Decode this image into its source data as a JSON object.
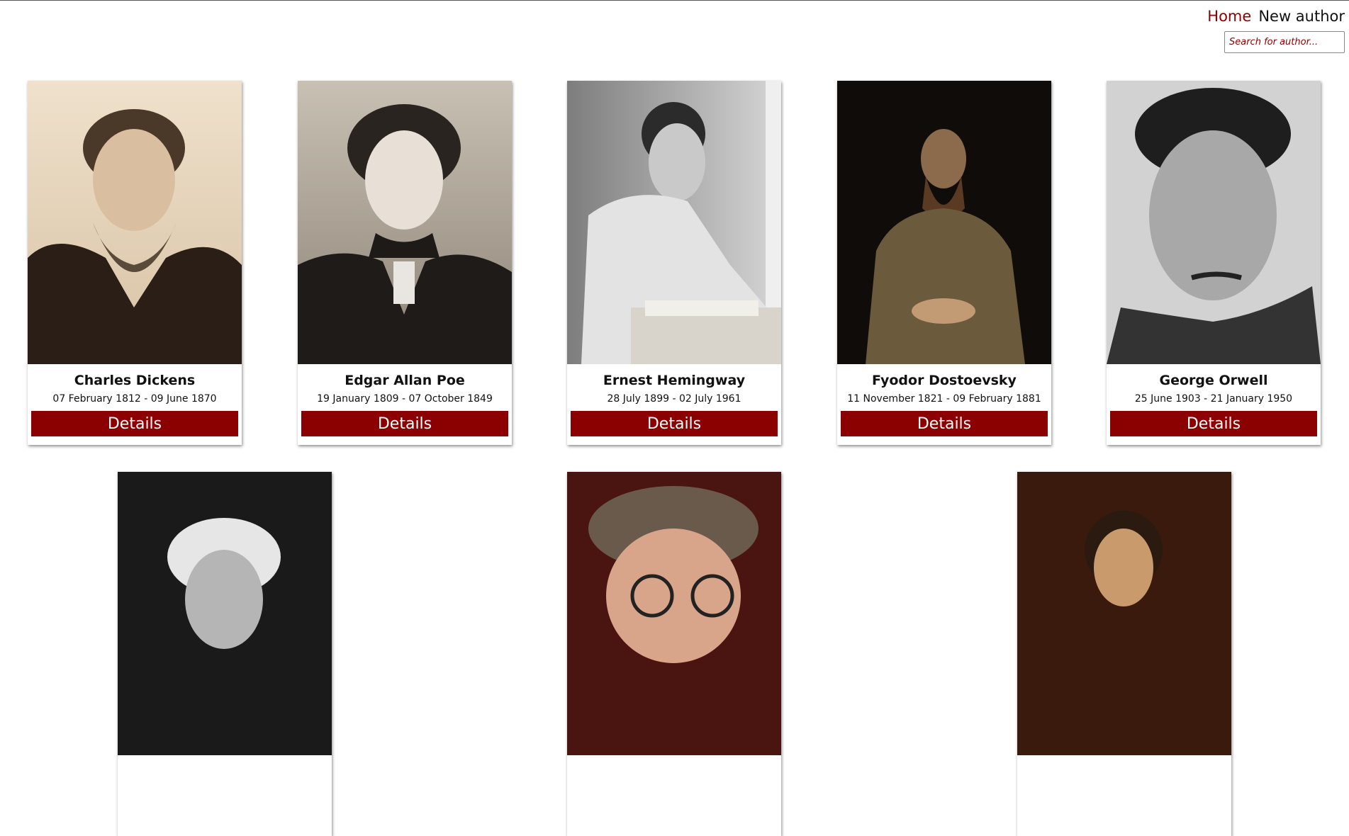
{
  "nav": {
    "home": "Home",
    "new_author": "New author"
  },
  "search": {
    "placeholder": "Search for author...",
    "value": ""
  },
  "authors": [
    {
      "name": "Charles Dickens",
      "dates": "07 February 1812 - 09 June 1870",
      "details": "Details"
    },
    {
      "name": "Edgar Allan Poe",
      "dates": "19 January 1809 - 07 October 1849",
      "details": "Details"
    },
    {
      "name": "Ernest Hemingway",
      "dates": "28 July 1899 - 02 July 1961",
      "details": "Details"
    },
    {
      "name": "Fyodor Dostoevsky",
      "dates": "11 November 1821 - 09 February 1881",
      "details": "Details"
    },
    {
      "name": "George Orwell",
      "dates": "25 June 1903 - 21 January 1950",
      "details": "Details"
    }
  ],
  "colors": {
    "accent": "#8b0000",
    "text": "#111111",
    "background": "#ffffff"
  }
}
